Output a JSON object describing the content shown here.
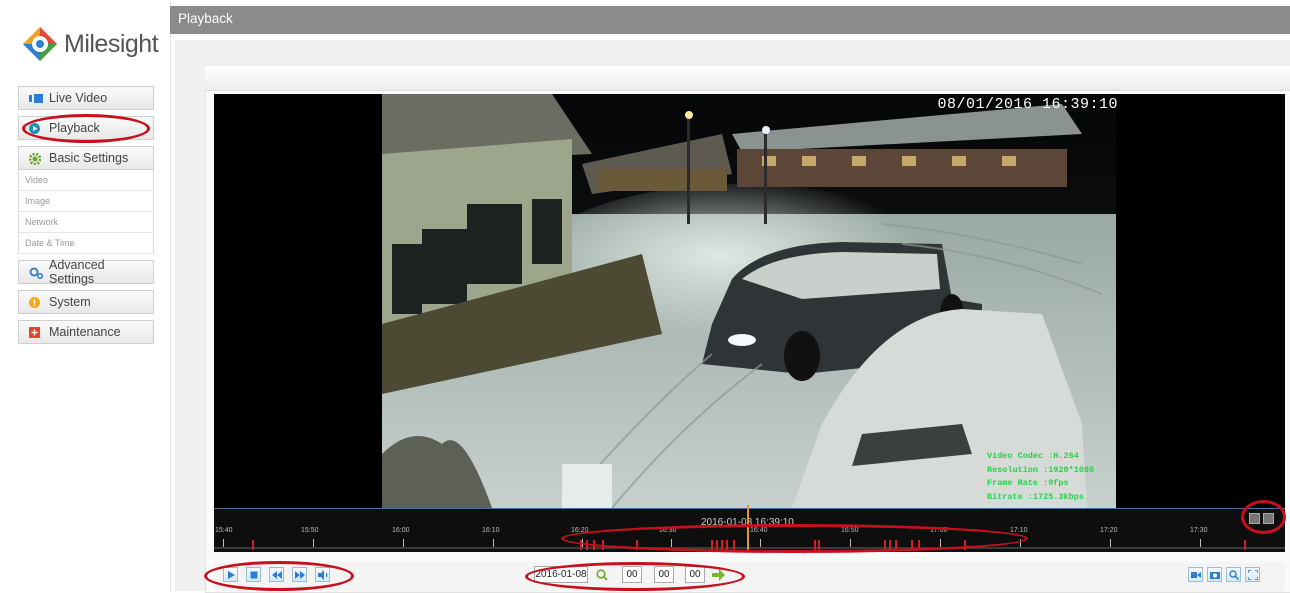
{
  "app": {
    "brand": "Milesight",
    "page_title": "Playback"
  },
  "sidebar": {
    "items": [
      {
        "label": "Live Video",
        "icon": "live-video-icon"
      },
      {
        "label": "Playback",
        "icon": "playback-icon"
      },
      {
        "label": "Basic Settings",
        "icon": "gear-icon"
      },
      {
        "label": "Advanced Settings",
        "icon": "gears-icon"
      },
      {
        "label": "System",
        "icon": "info-icon"
      },
      {
        "label": "Maintenance",
        "icon": "plus-icon"
      }
    ],
    "basic_sub": [
      "Video",
      "Image",
      "Network",
      "Date & Time"
    ]
  },
  "video": {
    "osd_timestamp": "08/01/2016 16:39:10",
    "osd_lines": [
      "Video Codec :H.264",
      "Resolution :1920*1080",
      "Frame Rate :9fps",
      "Bitrate :1725.3kbps"
    ]
  },
  "timeline": {
    "current": "2016-01-08 16:39:10",
    "labels": [
      "15:40",
      "15:50",
      "16:00",
      "16:10",
      "16:20",
      "16:30",
      "16:40",
      "16:50",
      "17:00",
      "17:10",
      "17:20",
      "17:30"
    ]
  },
  "search": {
    "date": "2016-01-08",
    "hour": "00",
    "minute": "00",
    "second": "00"
  },
  "colors": {
    "header": "#8b8b8b",
    "annotation": "#c8101c",
    "record": "#d21f1f",
    "cursor": "#e29a1a"
  }
}
